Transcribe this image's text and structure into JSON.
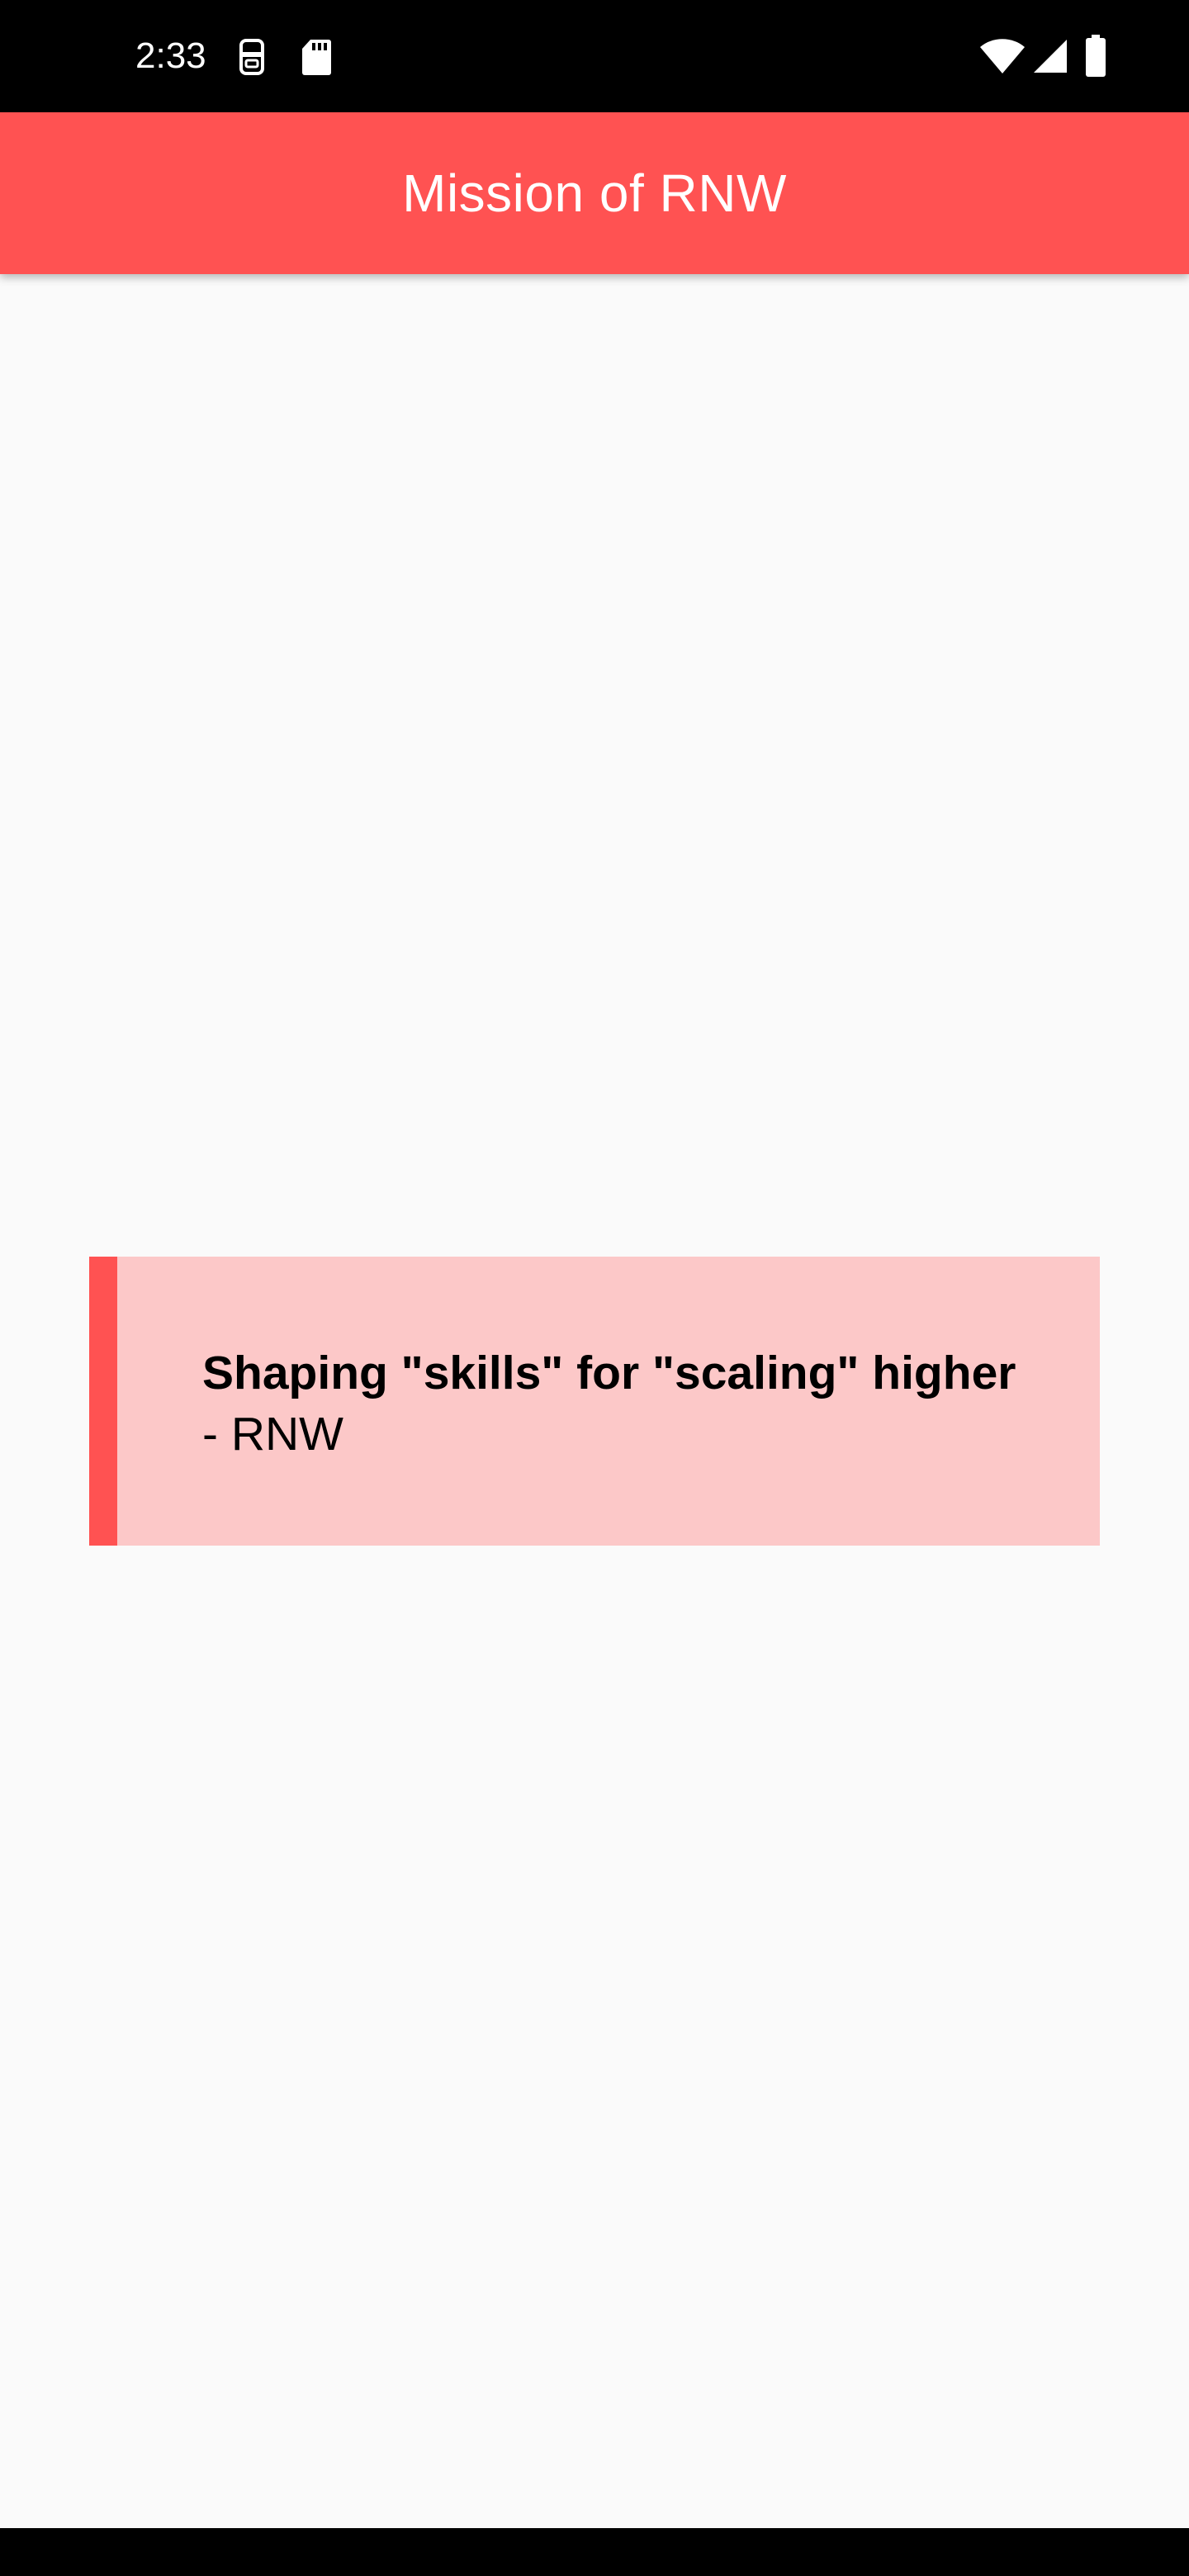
{
  "status_bar": {
    "time": "2:33",
    "icons": [
      "sim-card-icon",
      "sd-card-icon",
      "wifi-icon",
      "cellular-signal-icon",
      "battery-icon"
    ]
  },
  "app_bar": {
    "title": "Mission of RNW",
    "color": "#ff5252"
  },
  "quote": {
    "text": "Shaping \"skills\" for \"scaling\" higher",
    "author": "- RNW",
    "background": "#fcc8c8",
    "accent": "#ff5252"
  }
}
